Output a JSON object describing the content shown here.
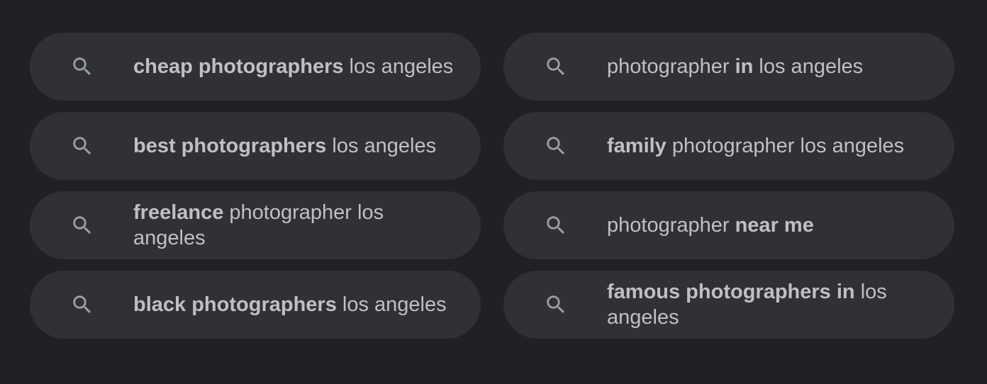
{
  "colors": {
    "background": "#202124",
    "chip_background": "#303134",
    "text": "#bdc1c6",
    "icon": "#9aa0a6"
  },
  "icons": {
    "search": "search-icon"
  },
  "suggestions": [
    {
      "parts": [
        {
          "text": "cheap photographers",
          "bold": true
        },
        {
          "text": " los angeles",
          "bold": false
        }
      ]
    },
    {
      "parts": [
        {
          "text": "photographer ",
          "bold": false
        },
        {
          "text": "in",
          "bold": true
        },
        {
          "text": " los angeles",
          "bold": false
        }
      ]
    },
    {
      "parts": [
        {
          "text": "best photographers",
          "bold": true
        },
        {
          "text": " los angeles",
          "bold": false
        }
      ]
    },
    {
      "parts": [
        {
          "text": "family",
          "bold": true
        },
        {
          "text": " photographer los angeles",
          "bold": false
        }
      ]
    },
    {
      "parts": [
        {
          "text": "freelance",
          "bold": true
        },
        {
          "text": " photographer los angeles",
          "bold": false
        }
      ]
    },
    {
      "parts": [
        {
          "text": "photographer ",
          "bold": false
        },
        {
          "text": "near me",
          "bold": true
        }
      ]
    },
    {
      "parts": [
        {
          "text": "black photographers",
          "bold": true
        },
        {
          "text": " los angeles",
          "bold": false
        }
      ]
    },
    {
      "parts": [
        {
          "text": "famous photographers in",
          "bold": true
        },
        {
          "text": " los angeles",
          "bold": false
        }
      ]
    }
  ]
}
